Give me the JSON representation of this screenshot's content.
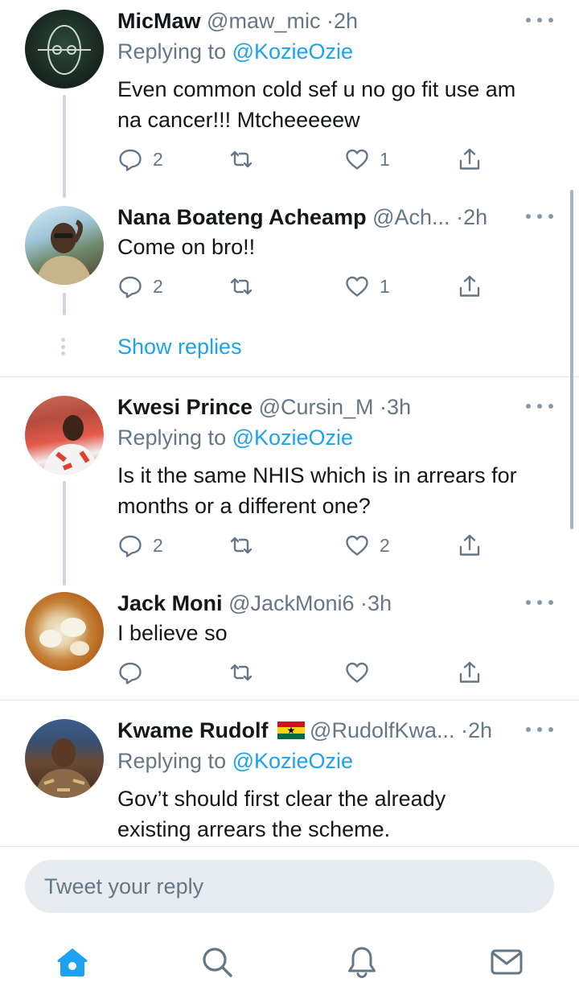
{
  "tweets": [
    {
      "name": "MicMaw",
      "handle": "@maw_mic",
      "time": "2h",
      "replying_prefix": "Replying to ",
      "replying_to": "@KozieOzie",
      "lines": [
        "Even common cold sef u no go fit use am",
        "na cancer!!! Mtcheeeeew"
      ],
      "replies": "2",
      "retweets": "",
      "likes": "1"
    },
    {
      "name": "Nana Boateng Acheamp",
      "handle": "@Ach...",
      "time": "2h",
      "lines": [
        "Come on bro!!"
      ],
      "replies": "2",
      "retweets": "",
      "likes": "1"
    },
    {
      "name": "Kwesi Prince",
      "handle": "@Cursin_M",
      "time": "3h",
      "replying_prefix": "Replying to ",
      "replying_to": "@KozieOzie",
      "lines": [
        "Is it the same NHIS which is in arrears for",
        "months or a different one?"
      ],
      "replies": "2",
      "retweets": "",
      "likes": "2"
    },
    {
      "name": "Jack Moni",
      "handle": "@JackMoni6",
      "time": "3h",
      "lines": [
        "I believe so"
      ],
      "replies": "",
      "retweets": "",
      "likes": ""
    },
    {
      "name": "Kwame Rudolf",
      "handle": "@RudolfKwa...",
      "time": "2h",
      "replying_prefix": "Replying to ",
      "replying_to": "@KozieOzie",
      "lines": [
        "Gov’t should first clear the already",
        "existing arrears the scheme."
      ]
    }
  ],
  "separator": "·",
  "show_replies": "Show replies",
  "reply_bar": {
    "placeholder": "Tweet your reply"
  },
  "tabs": [
    {
      "icon": "home-icon",
      "active": true
    },
    {
      "icon": "search-icon"
    },
    {
      "icon": "bell-icon"
    },
    {
      "icon": "mail-icon"
    }
  ],
  "colors": {
    "accent": "#1da1f2",
    "secondary_text": "#657786",
    "thread_line": "#ccd6dd",
    "input_bg": "#e6ecf0",
    "flag": [
      "#ce1126",
      "#fcd116",
      "#006b3f"
    ]
  }
}
